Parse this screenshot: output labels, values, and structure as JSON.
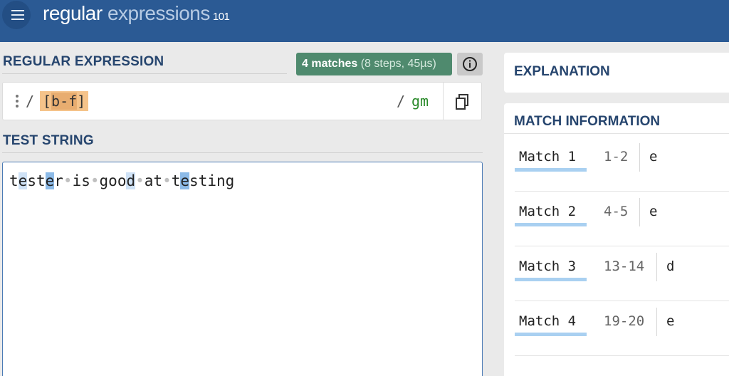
{
  "header": {
    "logo_main": "regular",
    "logo_light": " expressions",
    "logo_version": "101"
  },
  "regex": {
    "section_title": "REGULAR EXPRESSION",
    "match_count": "4 matches",
    "match_stats": " (8 steps, 45µs)",
    "delimiter_open": "/",
    "expression_parts": [
      "[",
      "b-f",
      "]"
    ],
    "delimiter_close": "/",
    "flags": "gm"
  },
  "test": {
    "section_title": "TEST STRING",
    "segments": [
      {
        "t": "t",
        "c": ""
      },
      {
        "t": "e",
        "c": "hl2"
      },
      {
        "t": "st",
        "c": ""
      },
      {
        "t": "e",
        "c": "hl"
      },
      {
        "t": "r",
        "c": ""
      },
      {
        "t": "•",
        "c": "ws"
      },
      {
        "t": "is",
        "c": ""
      },
      {
        "t": "•",
        "c": "ws"
      },
      {
        "t": "goo",
        "c": ""
      },
      {
        "t": "d",
        "c": "hl2"
      },
      {
        "t": "•",
        "c": "ws"
      },
      {
        "t": "at",
        "c": ""
      },
      {
        "t": "•",
        "c": "ws"
      },
      {
        "t": "t",
        "c": ""
      },
      {
        "t": "e",
        "c": "hl"
      },
      {
        "t": "sting",
        "c": ""
      }
    ]
  },
  "explanation": {
    "title": "EXPLANATION"
  },
  "match_info": {
    "title": "MATCH INFORMATION",
    "matches": [
      {
        "label": "Match 1",
        "range": "1-2",
        "value": "e"
      },
      {
        "label": "Match 2",
        "range": "4-5",
        "value": "e"
      },
      {
        "label": "Match 3",
        "range": "13-14",
        "value": "d"
      },
      {
        "label": "Match 4",
        "range": "19-20",
        "value": "e"
      }
    ]
  },
  "colors": {
    "header_bg": "#2b5a94",
    "match_badge_bg": "#4f8a6e",
    "regex_highlight": "#f5c38a",
    "match_highlight": "#8dbbe8",
    "flags": "#2a8a2a"
  },
  "icons": {
    "menu": "hamburger-icon",
    "info": "info-icon",
    "copy": "copy-icon",
    "options": "kebab-icon"
  }
}
